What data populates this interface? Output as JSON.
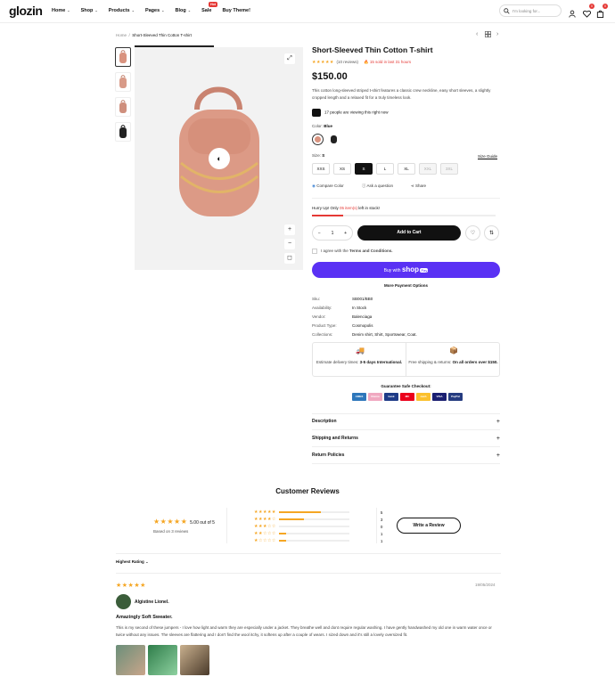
{
  "header": {
    "logo": "glozin",
    "nav": [
      {
        "label": "Home",
        "caret": true
      },
      {
        "label": "Shop",
        "caret": true
      },
      {
        "label": "Products",
        "caret": true
      },
      {
        "label": "Pages",
        "caret": true
      },
      {
        "label": "Blog",
        "caret": true
      },
      {
        "label": "Sale",
        "caret": false,
        "badge": "Hot"
      },
      {
        "label": "Buy Theme!",
        "caret": false
      }
    ],
    "search_placeholder": "I'm looking for...",
    "wishlist_count": "0",
    "cart_count": "0"
  },
  "breadcrumb": {
    "home": "Home",
    "current": "Short-Sleeved Thin Cotton T-shirt"
  },
  "product": {
    "title": "Short-Sleeved Thin Cotton T-shirt",
    "stars": "★★★★★",
    "reviews": "(10 reviews)",
    "sold": "15 sold in last 31 hours",
    "price": "$150.00",
    "description": "This cotton long-sleeved striped t-shirt features a classic crew neckline, easy short sleeves, a slightly cropped length and a relaxed fit for a truly timeless look.",
    "viewing": "17 people are viewing this right now",
    "color_label": "Color:",
    "color_value": "Blue",
    "size_label": "Size:",
    "size_value": "S",
    "sizes": [
      {
        "label": "XXS",
        "state": "normal"
      },
      {
        "label": "XS",
        "state": "normal"
      },
      {
        "label": "S",
        "state": "selected"
      },
      {
        "label": "L",
        "state": "normal"
      },
      {
        "label": "XL",
        "state": "normal"
      },
      {
        "label": "XXL",
        "state": "disabled"
      },
      {
        "label": "3XL",
        "state": "disabled"
      }
    ],
    "size_guide": "Size Guide",
    "actions": [
      "Compare Color",
      "Ask a question",
      "Share"
    ],
    "hurry_prefix": "Hurry Up! Only ",
    "hurry_count": "05 item(s)",
    "hurry_suffix": " left in stock!",
    "stock_fill": 0.17,
    "qty": "1",
    "add_to_cart": "Add to Cart",
    "agree_prefix": "I agree with the ",
    "agree_link": "Terms and Conditions.",
    "buy_with": "Buy with",
    "shop_pay": "shop",
    "shop_pay_tag": "Pay",
    "more_payment": "More Payment Options",
    "meta": [
      {
        "k": "Sku:",
        "v": "SB001/BB0"
      },
      {
        "k": "Availability:",
        "v": "In Stock"
      },
      {
        "k": "Vendor:",
        "v": "Balenciaga"
      },
      {
        "k": "Product Type:",
        "v": "Cosmopolis"
      },
      {
        "k": "Collections:",
        "v": "Denim shirt, Shirt, Sportswear, Coat."
      }
    ],
    "delivery_prefix": "Estimate delivery times: ",
    "delivery_bold": "3-5 days International.",
    "free_prefix": "Free shipping & returns: ",
    "free_bold": "On all orders over $150.",
    "guarantee": "Guarantee Safe Checkout:",
    "payments": [
      {
        "name": "AMEX",
        "color": "#2e77bb"
      },
      {
        "name": "Klarna",
        "color": "#f0a8c0"
      },
      {
        "name": "bank",
        "color": "#1f3c88"
      },
      {
        "name": "MC",
        "color": "#eb001b"
      },
      {
        "name": "cash",
        "color": "#fbc02d"
      },
      {
        "name": "VISA",
        "color": "#1a1f71"
      },
      {
        "name": "PayPal",
        "color": "#253b80"
      }
    ],
    "accordions": [
      "Description",
      "Shipping and Returns",
      "Return Policies"
    ]
  },
  "reviews": {
    "title": "Customer Reviews",
    "avg_stars": "★★★★★",
    "avg": "5.00 out of 5",
    "based": "Based on 3 reviews",
    "rows": [
      {
        "stars": "★★★★★",
        "count": "5",
        "fill": 0.6
      },
      {
        "stars": "★★★★☆",
        "count": "3",
        "fill": 0.35
      },
      {
        "stars": "★★★☆☆",
        "count": "0",
        "fill": 0
      },
      {
        "stars": "★★☆☆☆",
        "count": "1",
        "fill": 0.1
      },
      {
        "stars": "★☆☆☆☆",
        "count": "1",
        "fill": 0.1
      }
    ],
    "write": "Write a Review",
    "sort": "Highest Rating",
    "item": {
      "stars": "★★★★★",
      "date": "19/05/2024",
      "name": "Algistine Lionel.",
      "heading": "Amazingly Soft Sweater.",
      "body": "This is my second of these jumpers - I love how light and warm they are especially under a jacket. They breathe well and dont require regular washing. I have gently handwashed my old one in warm water once or twice without any issues. The sleeves are flattering and I don't find the wool itchy, it softens up after a couple of wears. I sized down and it's still a lovely oversized fit."
    }
  },
  "colors": {
    "accent": "#e53935",
    "star": "#f5a623",
    "shop_pay": "#5a31f4"
  },
  "icons": [
    "search-icon",
    "user-icon",
    "heart-icon",
    "cart-icon",
    "expand-icon",
    "zoom-in-icon",
    "zoom-out-icon",
    "fullscreen-icon",
    "eye-icon",
    "compare-icon",
    "question-icon",
    "share-icon",
    "delivery-icon",
    "box-icon",
    "chevron-left-icon",
    "chevron-right-icon",
    "grid-icon",
    "compare-circle-icon"
  ]
}
